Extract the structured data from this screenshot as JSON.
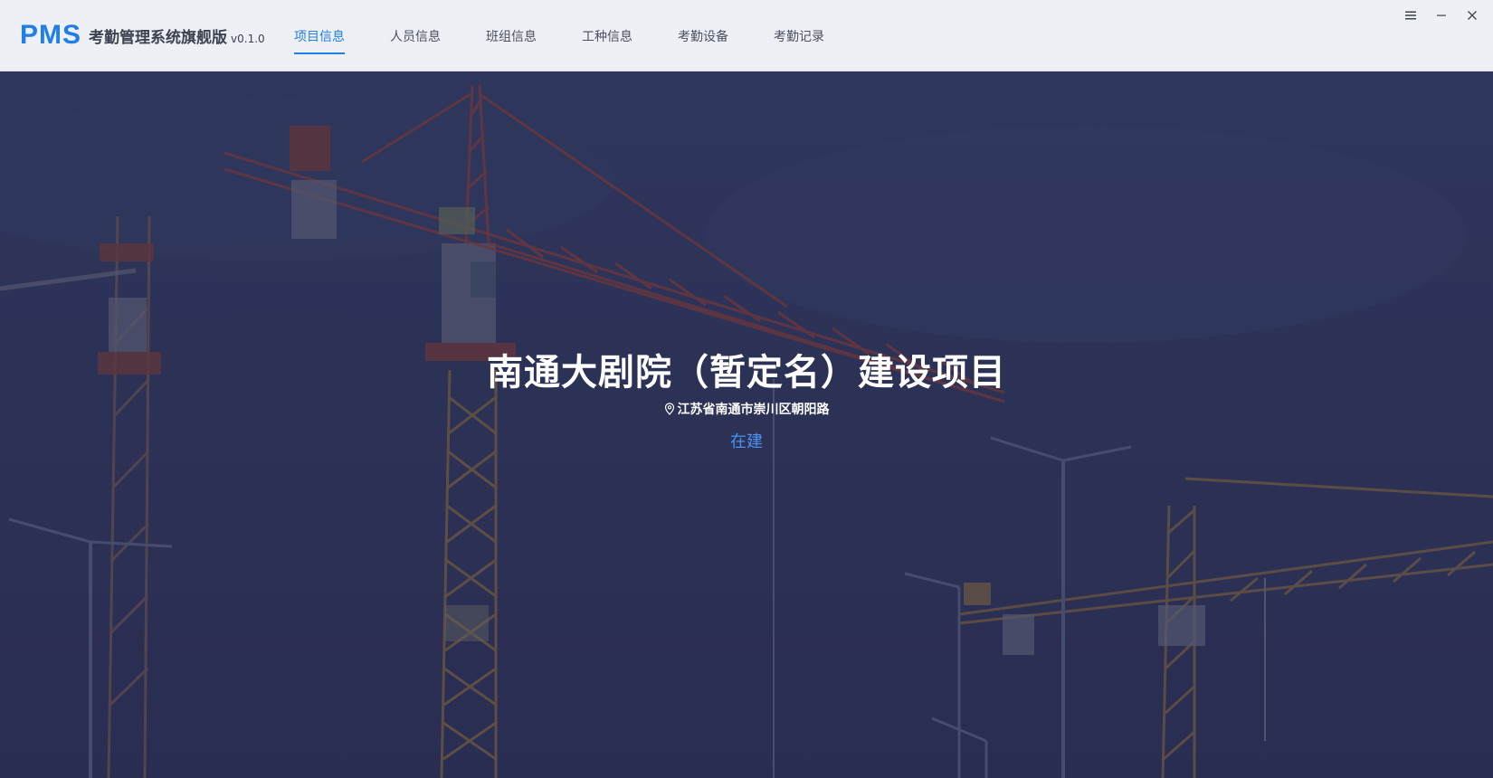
{
  "app": {
    "logo_text": "PMS",
    "name": "考勤管理系统旗舰版",
    "version": "v0.1.0"
  },
  "nav": {
    "items": [
      {
        "label": "项目信息",
        "active": true
      },
      {
        "label": "人员信息",
        "active": false
      },
      {
        "label": "班组信息",
        "active": false
      },
      {
        "label": "工种信息",
        "active": false
      },
      {
        "label": "考勤设备",
        "active": false
      },
      {
        "label": "考勤记录",
        "active": false
      }
    ]
  },
  "window_controls": {
    "menu_icon": "hamburger-icon",
    "minimize_icon": "minimize-icon",
    "close_icon": "close-icon"
  },
  "project": {
    "title": "南通大剧院（暂定名）建设项目",
    "address_icon": "location-pin-icon",
    "address": "江苏省南通市崇川区朝阳路",
    "status": "在建"
  },
  "colors": {
    "accent": "#1f7ee7",
    "status": "#4b93f0",
    "header_bg": "#eef0f5",
    "hero_bg": "#2f3557"
  }
}
